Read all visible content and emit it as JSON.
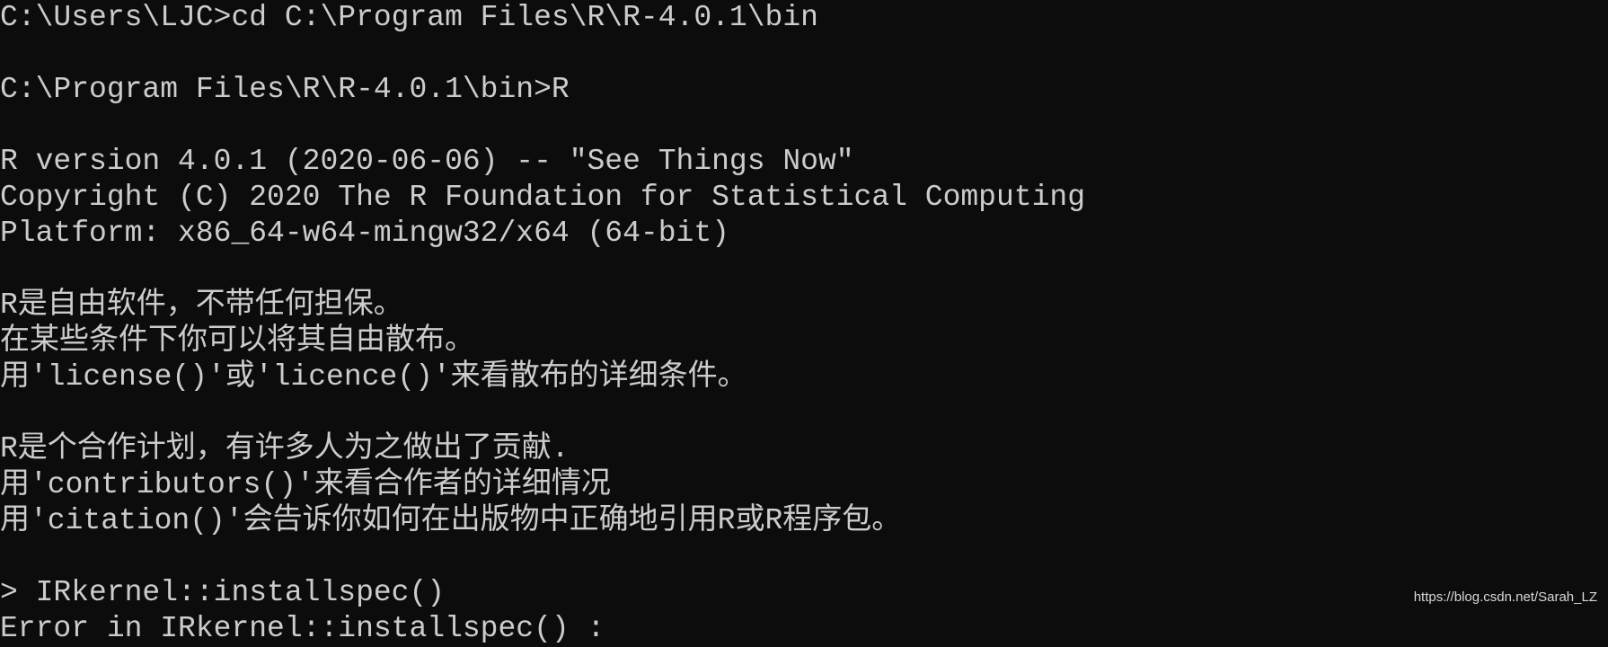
{
  "console": {
    "lines": [
      "C:\\Users\\LJC>cd C:\\Program Files\\R\\R-4.0.1\\bin",
      "",
      "C:\\Program Files\\R\\R-4.0.1\\bin>R",
      "",
      "R version 4.0.1 (2020-06-06) -- \"See Things Now\"",
      "Copyright (C) 2020 The R Foundation for Statistical Computing",
      "Platform: x86_64-w64-mingw32/x64 (64-bit)",
      "",
      "R是自由软件，不带任何担保。",
      "在某些条件下你可以将其自由散布。",
      "用'license()'或'licence()'来看散布的详细条件。",
      "",
      "R是个合作计划，有许多人为之做出了贡献.",
      "用'contributors()'来看合作者的详细情况",
      "用'citation()'会告诉你如何在出版物中正确地引用R或R程序包。",
      "",
      "> IRkernel::installspec()",
      "Error in IRkernel::installspec() :"
    ]
  },
  "watermark": "https://blog.csdn.net/Sarah_LZ"
}
